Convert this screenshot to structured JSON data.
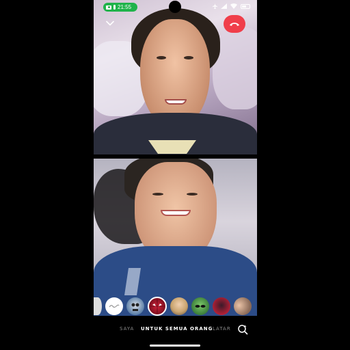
{
  "status_bar": {
    "time": "21:55",
    "battery_level_percent": 60,
    "icons": [
      "video-camera-icon",
      "microphone-icon",
      "airplane-mode-icon",
      "signal-icon",
      "wifi-icon",
      "battery-icon"
    ],
    "pill_color": "#1fb34a"
  },
  "call": {
    "collapse_icon": "chevron-down-icon",
    "end_call_icon": "phone-hangup-icon",
    "end_call_color": "#f03e4a",
    "remote_video": "remote-participant-video",
    "local_video": "self-view-video"
  },
  "effects": {
    "items": [
      {
        "name": "cut-off-effect"
      },
      {
        "name": "no-effect-squiggle"
      },
      {
        "name": "skull-mask-effect"
      },
      {
        "name": "spider-mask-effect",
        "selected": true
      },
      {
        "name": "blonde-avatar-effect"
      },
      {
        "name": "alien-effect"
      },
      {
        "name": "red-mask-effect"
      },
      {
        "name": "partial-face-effect"
      }
    ]
  },
  "modes": {
    "left_partial": "SAYA",
    "active": "UNTUK SEMUA ORANG",
    "right_partial": "LATAR"
  },
  "colors": {
    "background": "#000000",
    "tab_dim": "#8a8a8a",
    "tab_active": "#ffffff"
  }
}
